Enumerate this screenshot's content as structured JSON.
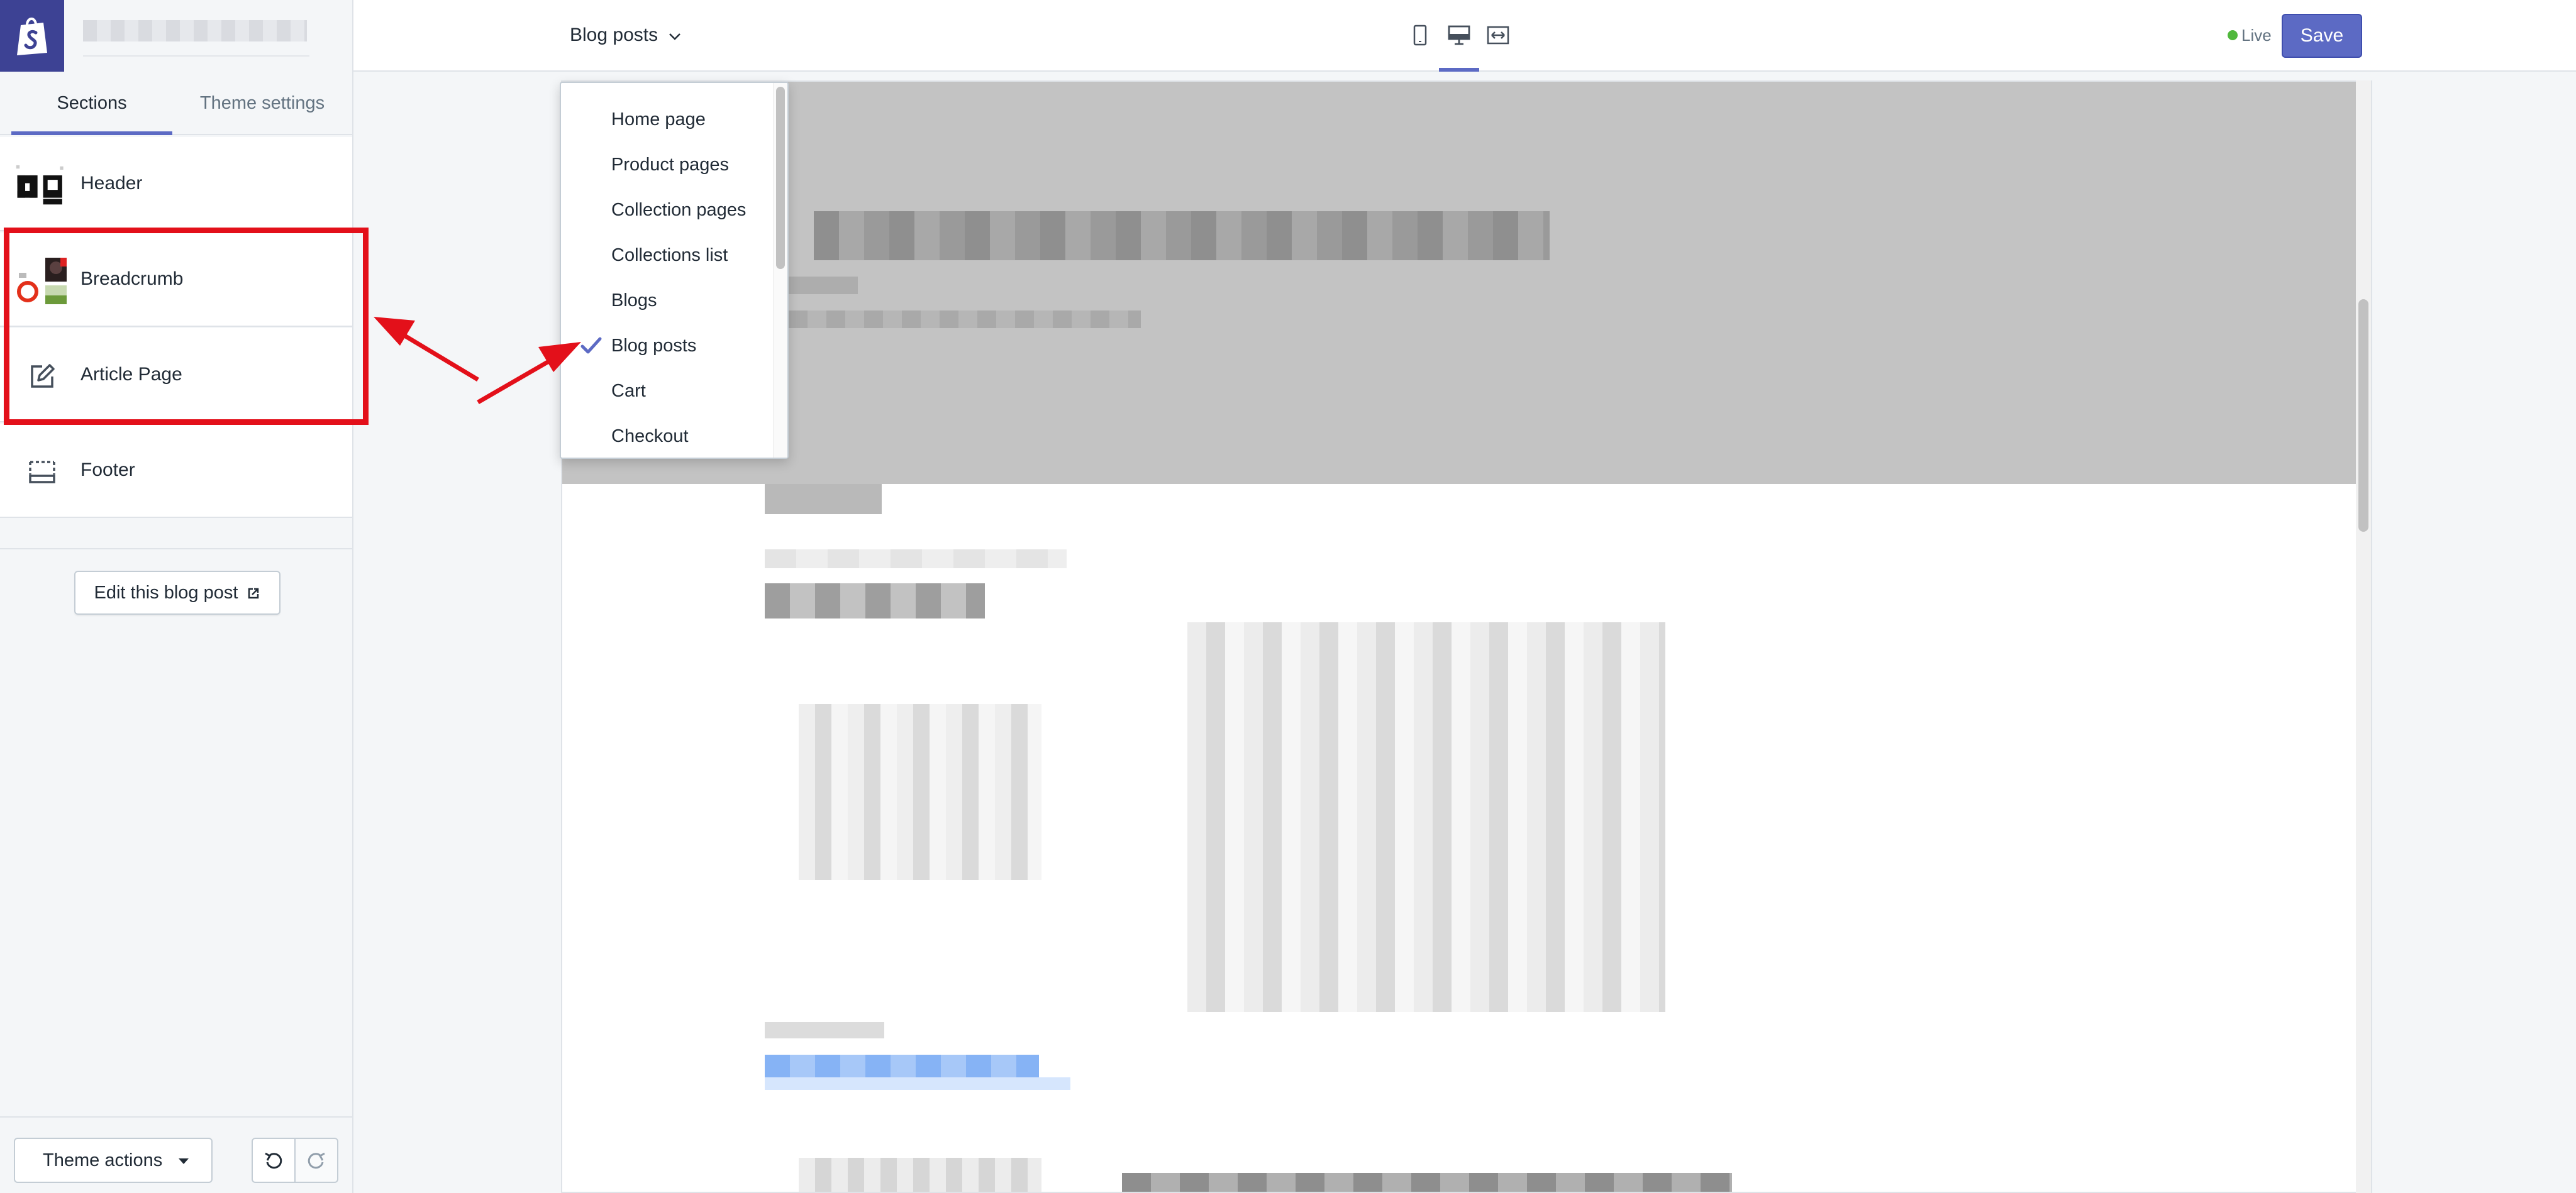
{
  "sidebar": {
    "tabs": [
      "Sections",
      "Theme settings"
    ],
    "sections": [
      {
        "label": "Header",
        "icon": "header-logo-thumbnail"
      },
      {
        "label": "Breadcrumb",
        "icon": "breadcrumb-thumbnail"
      },
      {
        "label": "Article Page",
        "icon": "edit-icon"
      },
      {
        "label": "Footer",
        "icon": "footer-layout-icon"
      }
    ],
    "edit_post_label": "Edit this blog post",
    "theme_actions_label": "Theme actions"
  },
  "topbar": {
    "page_selector": "Blog posts",
    "live_label": "Live",
    "save_label": "Save",
    "view_icons": [
      "mobile-view-icon",
      "desktop-view-icon",
      "fullscreen-view-icon"
    ]
  },
  "dropdown": {
    "items": [
      "Home page",
      "Product pages",
      "Collection pages",
      "Collections list",
      "Blogs",
      "Blog posts",
      "Cart",
      "Checkout"
    ],
    "selected": "Blog posts"
  },
  "colors": {
    "accent": "#5c6ac4",
    "annotation": "#e3101a",
    "live": "#50b83c",
    "logo_bg": "#3d4294"
  }
}
